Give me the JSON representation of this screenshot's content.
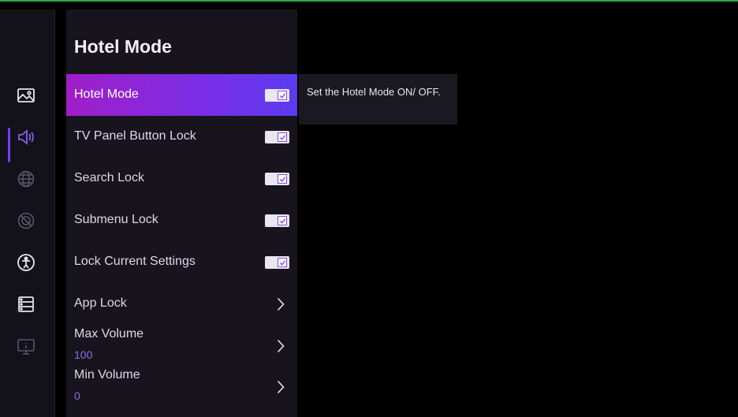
{
  "colors": {
    "accent": "#7b3cf0",
    "active_gradient_start": "#a01ec8",
    "active_gradient_end": "#5b3cf0",
    "panel_bg": "#17141e"
  },
  "rail": {
    "icons": [
      "picture-icon",
      "sound-icon",
      "network-icon",
      "privacy-icon",
      "accessibility-icon",
      "system-icon",
      "support-icon"
    ],
    "active_index": 1
  },
  "menu": {
    "title": "Hotel Mode",
    "items": [
      {
        "label": "Hotel Mode",
        "control": "checkbox",
        "checked": true,
        "active": true
      },
      {
        "label": "TV Panel Button Lock",
        "control": "checkbox",
        "checked": true
      },
      {
        "label": "Search Lock",
        "control": "checkbox",
        "checked": true
      },
      {
        "label": "Submenu Lock",
        "control": "checkbox",
        "checked": true
      },
      {
        "label": "Lock Current Settings",
        "control": "checkbox",
        "checked": true
      },
      {
        "label": "App Lock",
        "control": "chevron"
      },
      {
        "label": "Max Volume",
        "value": "100",
        "control": "chevron"
      },
      {
        "label": "Min Volume",
        "value": "0",
        "control": "chevron"
      }
    ]
  },
  "tooltip": {
    "text": "Set the Hotel Mode ON/ OFF."
  }
}
